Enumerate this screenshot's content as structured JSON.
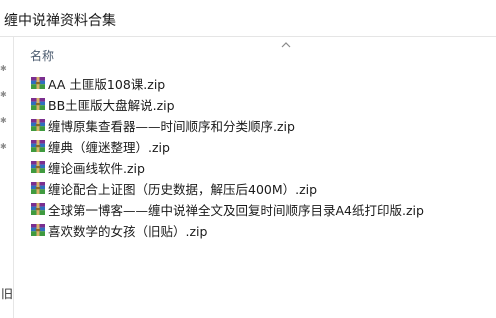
{
  "window": {
    "title": "缠中说禅资料合集"
  },
  "header": {
    "name_col": "名称"
  },
  "left_pane": {
    "cut_text": "旧"
  },
  "files": [
    "AA 土匪版108课.zip",
    "BB土匪版大盘解说.zip",
    "缠博原集查看器——时间顺序和分类顺序.zip",
    "缠典（缠迷整理）.zip",
    "缠论画线软件.zip",
    "缠论配合上证图（历史数据，解压后400M）.zip",
    "全球第一博客——缠中说禅全文及回复时间顺序目录A4纸打印版.zip",
    "喜欢数学的女孩（旧贴）.zip"
  ],
  "icons": {
    "file": "winrar-archive-icon",
    "pin": "pin-icon",
    "sort": "sort-up-icon"
  }
}
